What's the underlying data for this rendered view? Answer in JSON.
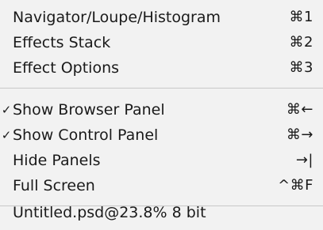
{
  "menu": {
    "group1": [
      {
        "label": "Navigator/Loupe/Histogram",
        "shortcut": "⌘1"
      },
      {
        "label": "Effects Stack",
        "shortcut": "⌘2"
      },
      {
        "label": "Effect Options",
        "shortcut": "⌘3"
      }
    ],
    "group2": [
      {
        "label": "Show Browser Panel",
        "shortcut": "⌘←",
        "checked": true,
        "check_glyph": "✓"
      },
      {
        "label": "Show Control Panel",
        "shortcut": "⌘→",
        "checked": true,
        "check_glyph": "✓"
      },
      {
        "label": "Hide Panels",
        "shortcut": "→|"
      },
      {
        "label": "Full Screen",
        "shortcut": "^⌘F"
      }
    ],
    "status_text": "Untitled.psd@23.8% 8 bit"
  }
}
